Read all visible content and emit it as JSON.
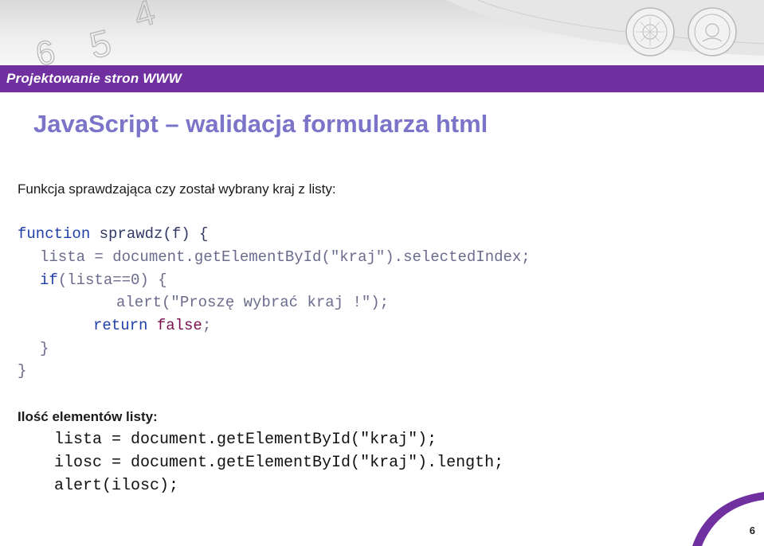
{
  "header": {
    "title": "Projektowanie stron WWW"
  },
  "slide": {
    "title": "JavaScript – walidacja formularza html",
    "subtitle": "Funkcja sprawdzająca czy został wybrany kraj z listy:",
    "code_block_1": [
      {
        "kw": "function",
        "rest": " sprawdz(f) {"
      },
      {
        "kw": "",
        "rest": "lista = document.getElementById(\"kraj\").selectedIndex;"
      },
      {
        "kw": "if",
        "rest": "(lista==0) {"
      },
      {
        "kw": "",
        "rest": "alert(\"Proszę wybrać kraj !\");"
      },
      {
        "kw": "return",
        "kw2": "false",
        "rest": ";"
      },
      {
        "kw": "",
        "rest": "}"
      },
      {
        "kw": "",
        "rest": "}"
      }
    ],
    "heading_2": "Ilość elementów listy:",
    "code_block_2": [
      "lista = document.getElementById(\"kraj\");",
      "ilosc = document.getElementById(\"kraj\").length;",
      "alert(ilosc);"
    ]
  },
  "footer": {
    "page_number": "6"
  },
  "decor": {
    "numbers": [
      "6",
      "5",
      "4"
    ]
  },
  "colors": {
    "accent": "#7030a0",
    "title": "#7b74c8"
  }
}
